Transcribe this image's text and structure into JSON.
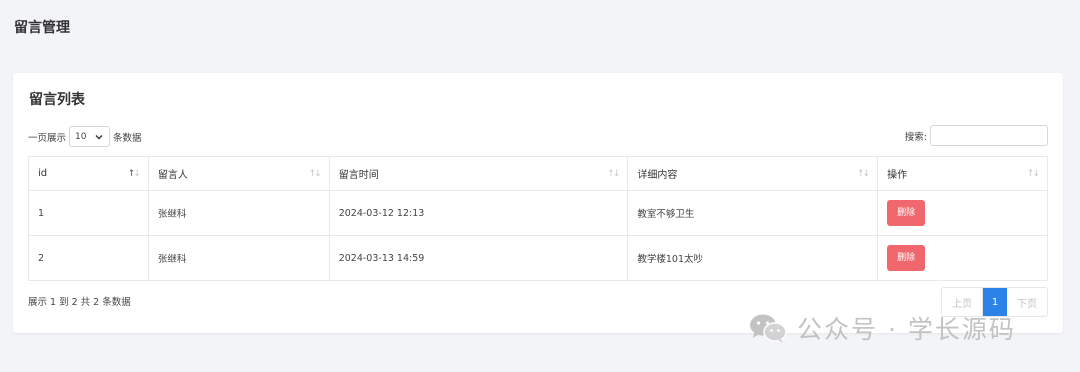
{
  "page": {
    "title": "留言管理"
  },
  "card": {
    "title": "留言列表"
  },
  "length_control": {
    "prefix": "一页展示",
    "value": "10",
    "suffix": "条数据"
  },
  "search": {
    "label": "搜索:",
    "value": "",
    "placeholder": ""
  },
  "table": {
    "headers": [
      "id",
      "留言人",
      "留言时间",
      "详细内容",
      "操作"
    ],
    "rows": [
      {
        "id": "1",
        "author": "张继科",
        "time": "2024-03-12 12:13",
        "content": "教室不够卫生",
        "action": "删除"
      },
      {
        "id": "2",
        "author": "张继科",
        "time": "2024-03-13 14:59",
        "content": "教学楼101太吵",
        "action": "删除"
      }
    ]
  },
  "info": "展示 1 到 2 共 2 条数据",
  "pagination": {
    "prev": "上页",
    "current": "1",
    "next": "下页"
  },
  "colors": {
    "accent": "#2b83e9",
    "danger": "#f0686d",
    "background": "#f3f4f8"
  },
  "watermark": {
    "text": "公众号 · 学长源码",
    "icon": "wechat-icon"
  }
}
